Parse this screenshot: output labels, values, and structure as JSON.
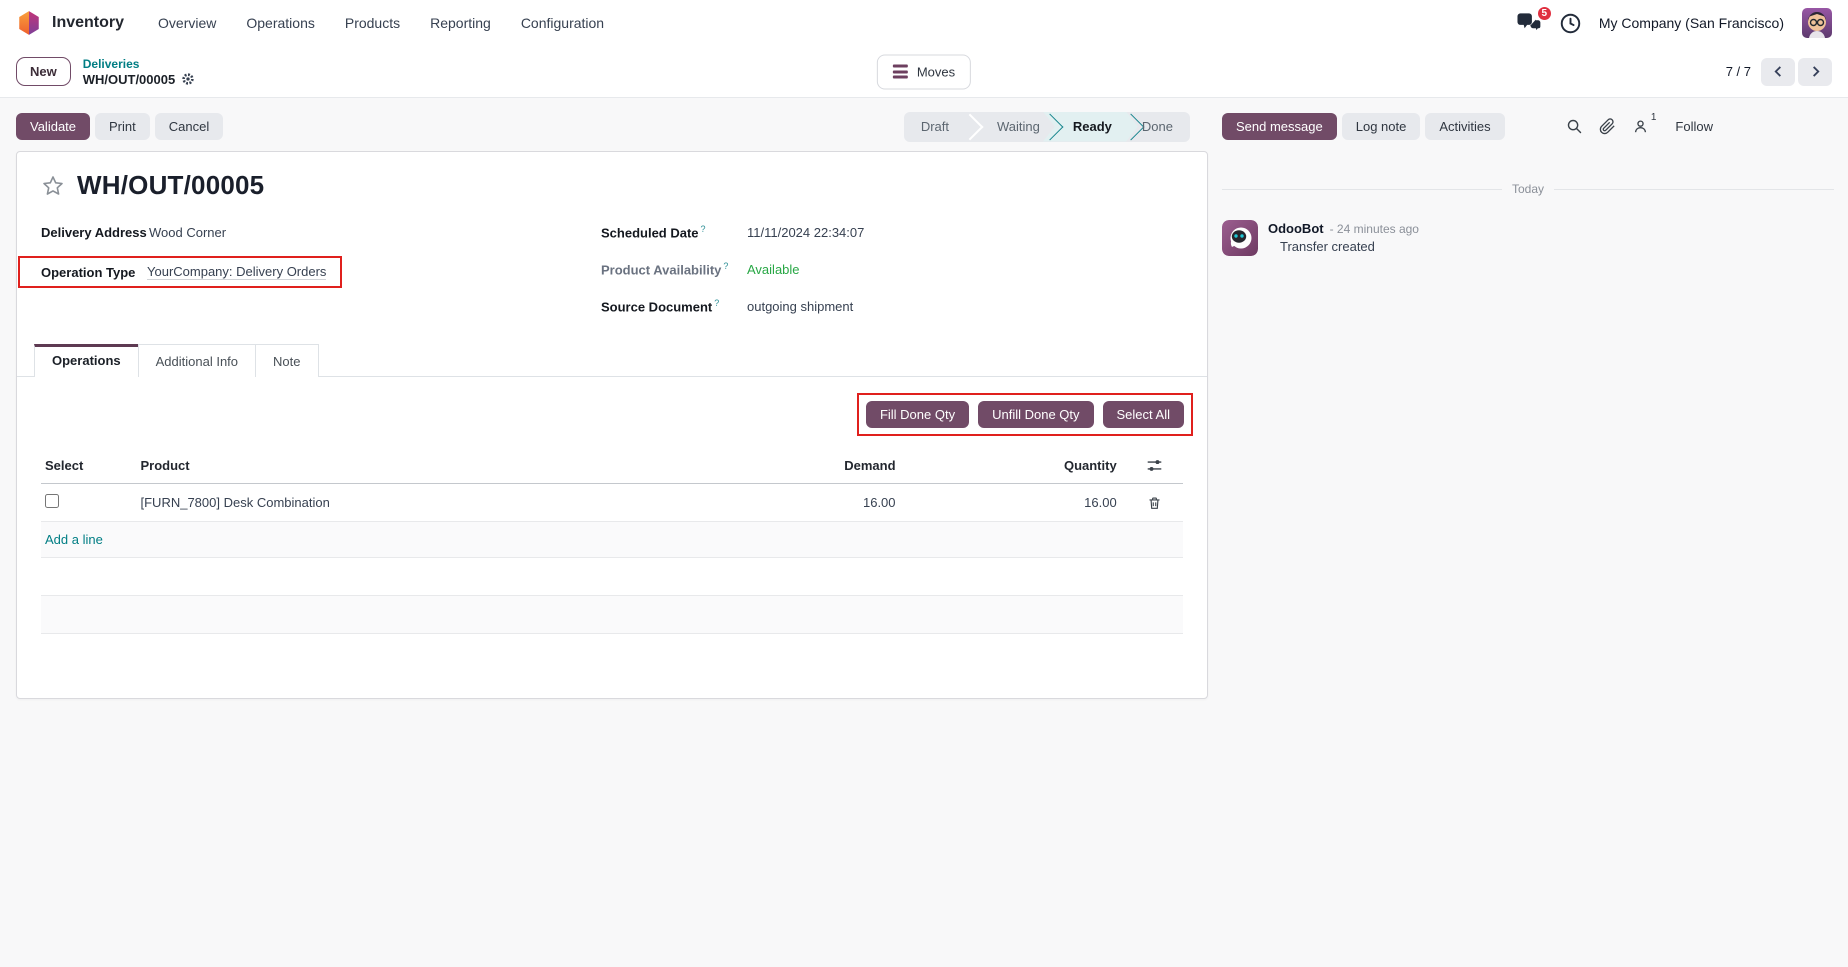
{
  "nav": {
    "app": "Inventory",
    "items": [
      "Overview",
      "Operations",
      "Products",
      "Reporting",
      "Configuration"
    ],
    "messages_badge": "5",
    "company": "My Company (San Francisco)"
  },
  "control": {
    "new_label": "New",
    "breadcrumb_parent": "Deliveries",
    "breadcrumb_current": "WH/OUT/00005",
    "moves_label": "Moves",
    "pager_count": "7 / 7"
  },
  "panel": {
    "validate": "Validate",
    "print": "Print",
    "cancel": "Cancel"
  },
  "statusbar": {
    "steps": [
      "Draft",
      "Waiting",
      "Ready",
      "Done"
    ],
    "active_step": "Ready"
  },
  "chatter": {
    "send_message": "Send message",
    "log_note": "Log note",
    "activities": "Activities",
    "followers_count": "1",
    "follow": "Follow",
    "date_divider": "Today",
    "message": {
      "author": "OdooBot",
      "time": "- 24 minutes ago",
      "body": "Transfer created"
    }
  },
  "form": {
    "title": "WH/OUT/00005",
    "help_marker": "?",
    "fields": {
      "delivery_address": {
        "label": "Delivery Address",
        "value": "Wood Corner"
      },
      "operation_type": {
        "label": "Operation Type",
        "value": "YourCompany: Delivery Orders"
      },
      "scheduled_date": {
        "label": "Scheduled Date",
        "value": "11/11/2024 22:34:07"
      },
      "product_availability": {
        "label": "Product Availability",
        "value": "Available"
      },
      "source_document": {
        "label": "Source Document",
        "value": "outgoing shipment"
      }
    },
    "tabs": [
      "Operations",
      "Additional Info",
      "Note"
    ],
    "actions": {
      "fill_done_qty": "Fill Done Qty",
      "unfill_done_qty": "Unfill Done Qty",
      "select_all": "Select All"
    },
    "table": {
      "headers": [
        "Select",
        "Product",
        "Demand",
        "Quantity"
      ],
      "rows": [
        {
          "product": "[FURN_7800] Desk Combination",
          "demand": "16.00",
          "quantity": "16.00"
        }
      ],
      "add_line": "Add a line"
    }
  },
  "colors": {
    "accent": "#714B67",
    "link_teal": "#017e84",
    "status_green": "#28a745",
    "annotation_red": "#e0201d",
    "badge_red": "#e03040"
  }
}
